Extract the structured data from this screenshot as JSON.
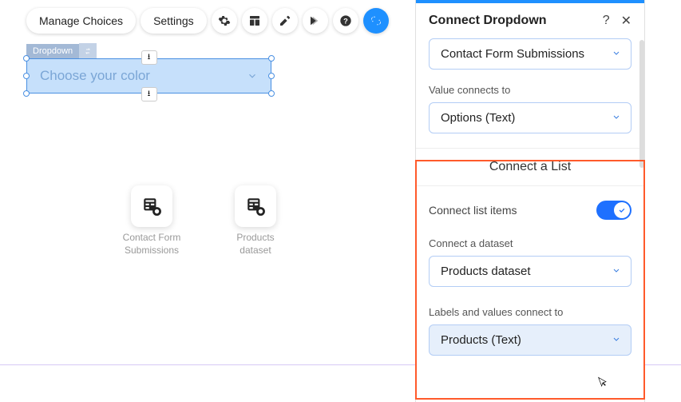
{
  "toolbar": {
    "manage_choices": "Manage Choices",
    "settings": "Settings"
  },
  "canvas": {
    "element_tag": "Dropdown",
    "placeholder": "Choose your color",
    "datasets": [
      {
        "label_line1": "Contact Form",
        "label_line2": "Submissions"
      },
      {
        "label_line1": "Products",
        "label_line2": "dataset"
      }
    ]
  },
  "panel": {
    "title": "Connect Dropdown",
    "dataset_select_value": "Contact Form Submissions",
    "value_connects_label": "Value connects to",
    "value_connects_value": "Options (Text)",
    "connect_list_header": "Connect a List",
    "connect_list_items_label": "Connect list items",
    "connect_dataset_label": "Connect a dataset",
    "connect_dataset_value": "Products dataset",
    "labels_values_label": "Labels and values connect to",
    "labels_values_value": "Products (Text)"
  }
}
